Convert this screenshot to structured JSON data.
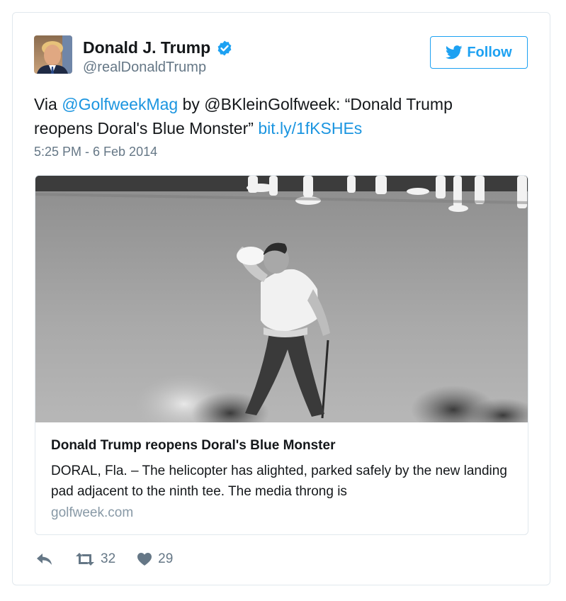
{
  "author": {
    "name": "Donald J. Trump",
    "handle": "@realDonaldTrump",
    "verified": true,
    "avatar_icon": "profile-photo"
  },
  "follow_button": {
    "label": "Follow",
    "icon": "twitter-bird-icon"
  },
  "tweet": {
    "prefix": "Via ",
    "mention1": "@GolfweekMag",
    "middle": " by @BKleinGolfweek: “Donald Trump reopens Doral's Blue Monster” ",
    "link": "bit.ly/1fKSHEs",
    "timestamp": "5:25 PM - 6 Feb 2014"
  },
  "card": {
    "image": "black-and-white photo of golfer celebrating on green",
    "title": "Donald Trump reopens Doral's Blue Monster",
    "description": "DORAL, Fla. – The helicopter has alighted, parked safely by the new landing pad adjacent to the ninth tee. The media throng is",
    "domain": "golfweek.com"
  },
  "actions": {
    "reply_icon": "reply-icon",
    "retweet_icon": "retweet-icon",
    "retweet_count": "32",
    "like_icon": "heart-icon",
    "like_count": "29"
  },
  "colors": {
    "link": "#1b95e0",
    "twitter_blue": "#1da1f2",
    "muted": "#657786",
    "border": "#e1e8ed"
  }
}
